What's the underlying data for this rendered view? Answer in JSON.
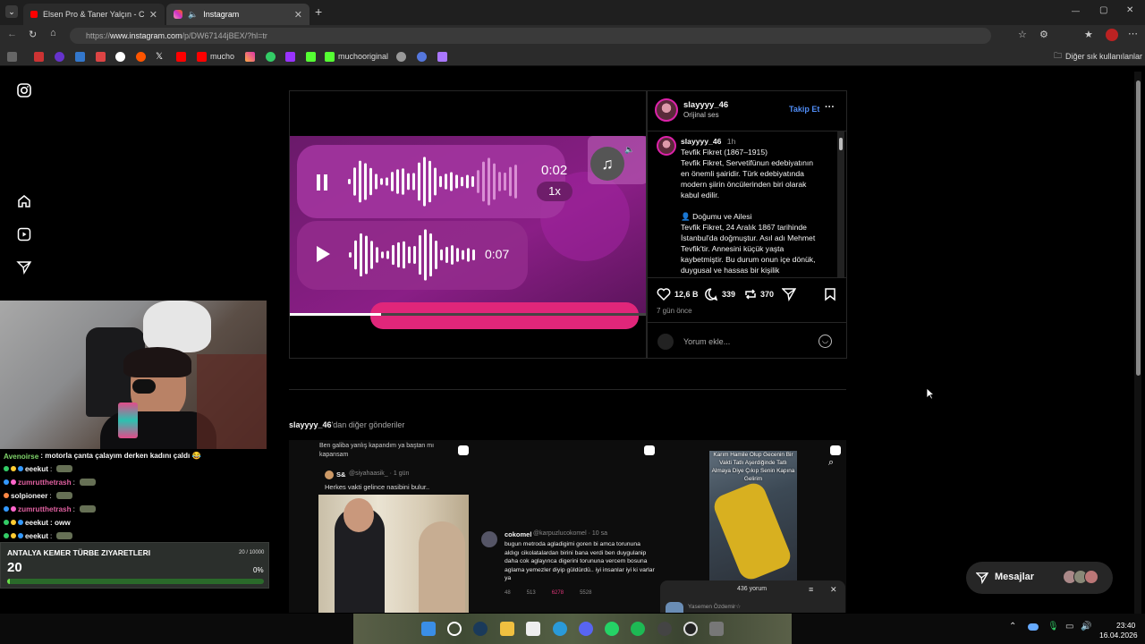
{
  "browser": {
    "tabs": [
      {
        "title": "Elsen Pro & Taner Yalçın - Chaki Ci"
      },
      {
        "title": "Instagram"
      }
    ],
    "new_tab": "+",
    "url_prefix": "https://",
    "url_host": "www.instagram.com",
    "url_path": "/p/DW67144jBEX/?hl=tr",
    "bookmarks": [
      "mucho",
      "muchooriginal"
    ],
    "other_bookmarks": "Diğer sık kullanılanlar",
    "window_controls": [
      "—",
      "▢",
      "✕"
    ]
  },
  "post": {
    "username": "slayyyy_46",
    "audio": "Orijinal ses",
    "follow": "Takip Et",
    "more": "···",
    "voice1_time": "0:02",
    "voice1_speed": "1x",
    "voice2_time": "0:07",
    "comment_time": "1h",
    "caption_lines": [
      "Tevfik Fikret (1867–1915)",
      "Tevfik Fikret, Servetifünun edebiyatının",
      "en önemli şairidir. Türk edebiyatında",
      "modern şiirin öncülerinden biri olarak",
      "kabul edilir."
    ],
    "section_title": "👤 Doğumu ve Ailesi",
    "section_lines": [
      "Tevfik Fikret, 24 Aralık 1867 tarihinde",
      "İstanbul'da doğmuştur. Asıl adı Mehmet",
      "Tevfik'tir. Annesini küçük yaşta",
      "kaybetmiştir. Bu durum onun içe dönük,",
      "duygusal ve hassas bir kişilik"
    ],
    "likes": "12,6 B",
    "comments": "339",
    "reposts": "370",
    "posted": "7 gün önce",
    "comment_placeholder": "Yorum ekle..."
  },
  "more_posts": {
    "header_user": "slayyyy_46",
    "header_suffix": "'dan diğer gönderiler",
    "thumb1": {
      "top_text": "Ben galiba yanlış kapandım ya baştan mı kapansam",
      "user": "S&",
      "handle": "@siyahaasik_ · 1 gün",
      "text": "Herkes vakti gelince nasibini bulur.."
    },
    "thumb2": {
      "user": "cokomel",
      "handle": "@karpuzlucokomel · 10 sa",
      "text": "bugun metroda agladigimi goren bi amca torununa aldıgı cikolatalardan birini bana verdi ben duygulanip daha cok aglayınca digerini torununa vercem bosuna aglama yemezler diyip güldürdü.. iyi insanlar iyi ki varlar ya",
      "stats": [
        "48",
        "513",
        "6278",
        "5528"
      ]
    },
    "thumb3": {
      "overlay_text": "Karım Hamile Olup Gecenin Bir Vakti Tatlı Aşerdiğinde Tatlı Almaya Diye Çıkıp Senin Kapına Gelirim",
      "comments_count": "436 yorum",
      "commenter": "Yasemen Özdemir☆"
    }
  },
  "stream": {
    "chat": [
      {
        "user": "Avenoirse",
        "text": ": motorla çanta çalayım derken kadını çaldı 😂",
        "color": "#7fd36a"
      },
      {
        "user": "eeekut",
        "text": ":",
        "color": "#f0f0f0"
      },
      {
        "user": "zumrutthetrash",
        "text": ":",
        "color": "#e060a0"
      },
      {
        "user": "solpioneer",
        "text": ":",
        "color": "#f0f0f0"
      },
      {
        "user": "zumrutthetrash",
        "text": ":",
        "color": "#e060a0"
      },
      {
        "user": "eeekut",
        "text": ": oww",
        "color": "#f0f0f0"
      },
      {
        "user": "eeekut",
        "text": ":",
        "color": "#f0f0f0"
      }
    ],
    "goal_title": "ANTALYA KEMER TÜRBE ZIYARETLERI",
    "goal_value": "20",
    "goal_progress": "20 / 10000",
    "goal_percent": "0%",
    "goal_fraction": 0.002
  },
  "messages": {
    "label": "Mesajlar"
  },
  "taskbar": {
    "time": "23:40",
    "date": "16.04.2026"
  }
}
